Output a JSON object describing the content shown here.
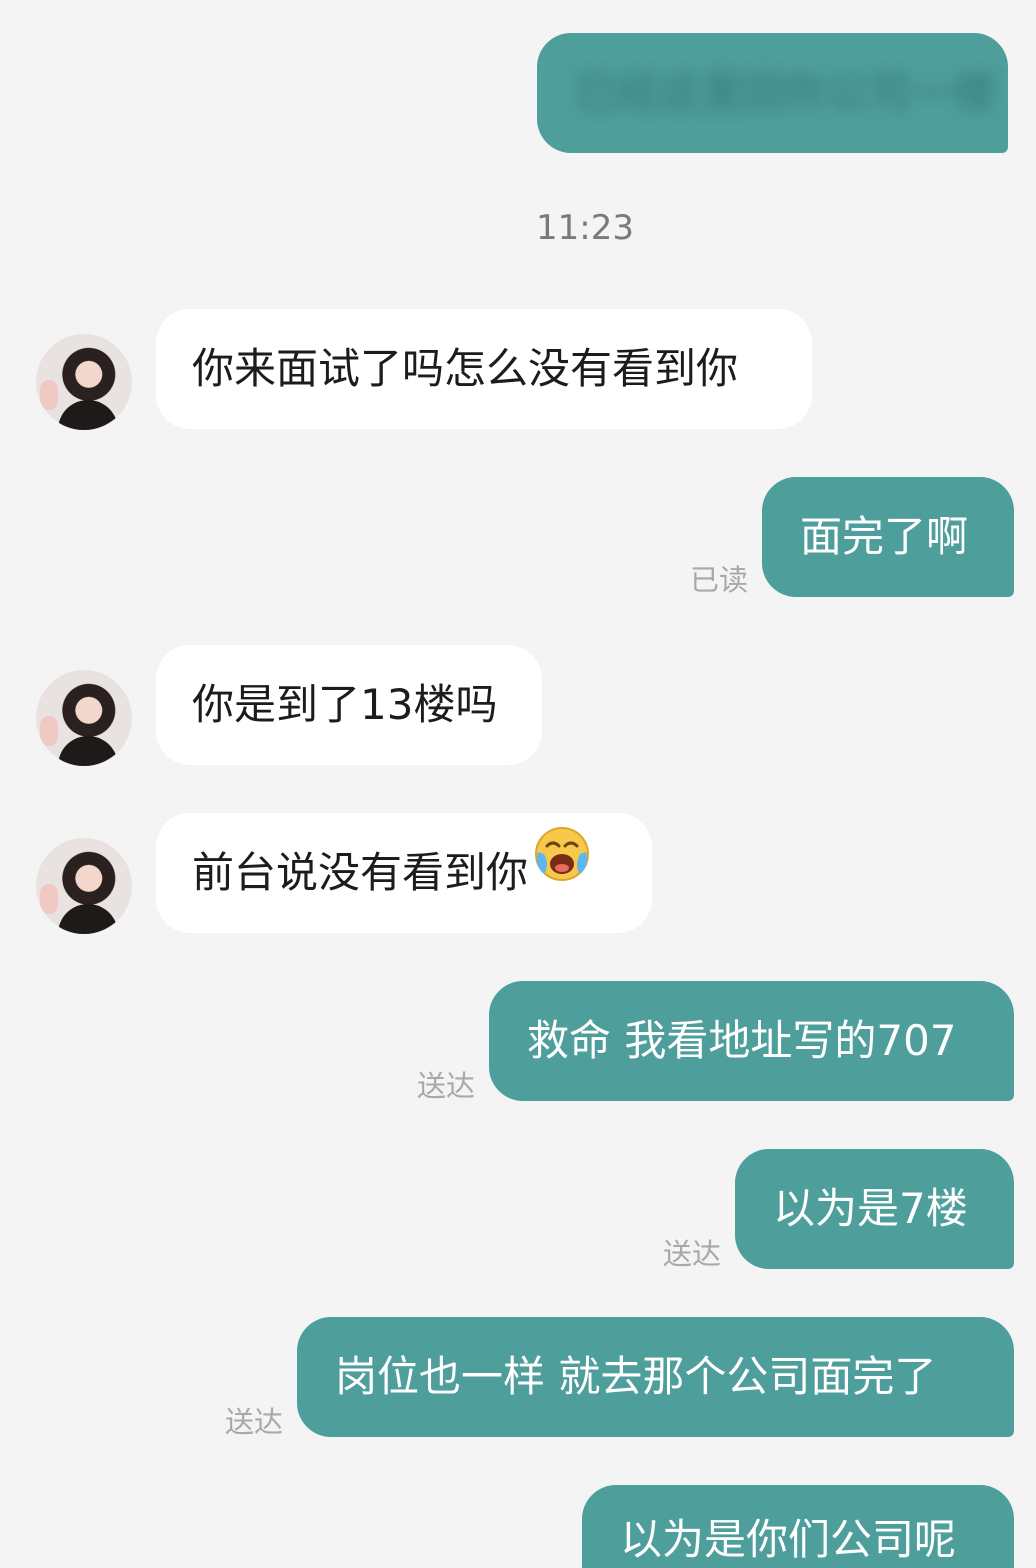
{
  "messages": [
    {
      "id": "m0",
      "direction": "out",
      "text": "已经这里回你公司一楼",
      "blurred": true
    },
    {
      "id": "m1",
      "direction": "in",
      "text": "你来面试了吗怎么没有看到你"
    },
    {
      "id": "m2",
      "direction": "out",
      "text": "面完了啊",
      "status": "已读"
    },
    {
      "id": "m3",
      "direction": "in",
      "text": "你是到了13楼吗"
    },
    {
      "id": "m4",
      "direction": "in",
      "text": "前台说没有看到你",
      "emoji": "loudly-crying-laughing-emoji"
    },
    {
      "id": "m5",
      "direction": "out",
      "text": "救命 我看地址写的707",
      "status": "送达"
    },
    {
      "id": "m6",
      "direction": "out",
      "text": "以为是7楼",
      "status": "送达"
    },
    {
      "id": "m7",
      "direction": "out",
      "text": "岗位也一样 就去那个公司面完了",
      "status": "送达"
    },
    {
      "id": "m8",
      "direction": "out",
      "text": "以为是你们公司呢"
    }
  ],
  "timestamp": "11:23",
  "colors": {
    "background": "#f4f4f4",
    "outgoing_bubble": "#4e9e9c",
    "incoming_bubble": "#ffffff",
    "status_text": "#a8a8a8"
  }
}
